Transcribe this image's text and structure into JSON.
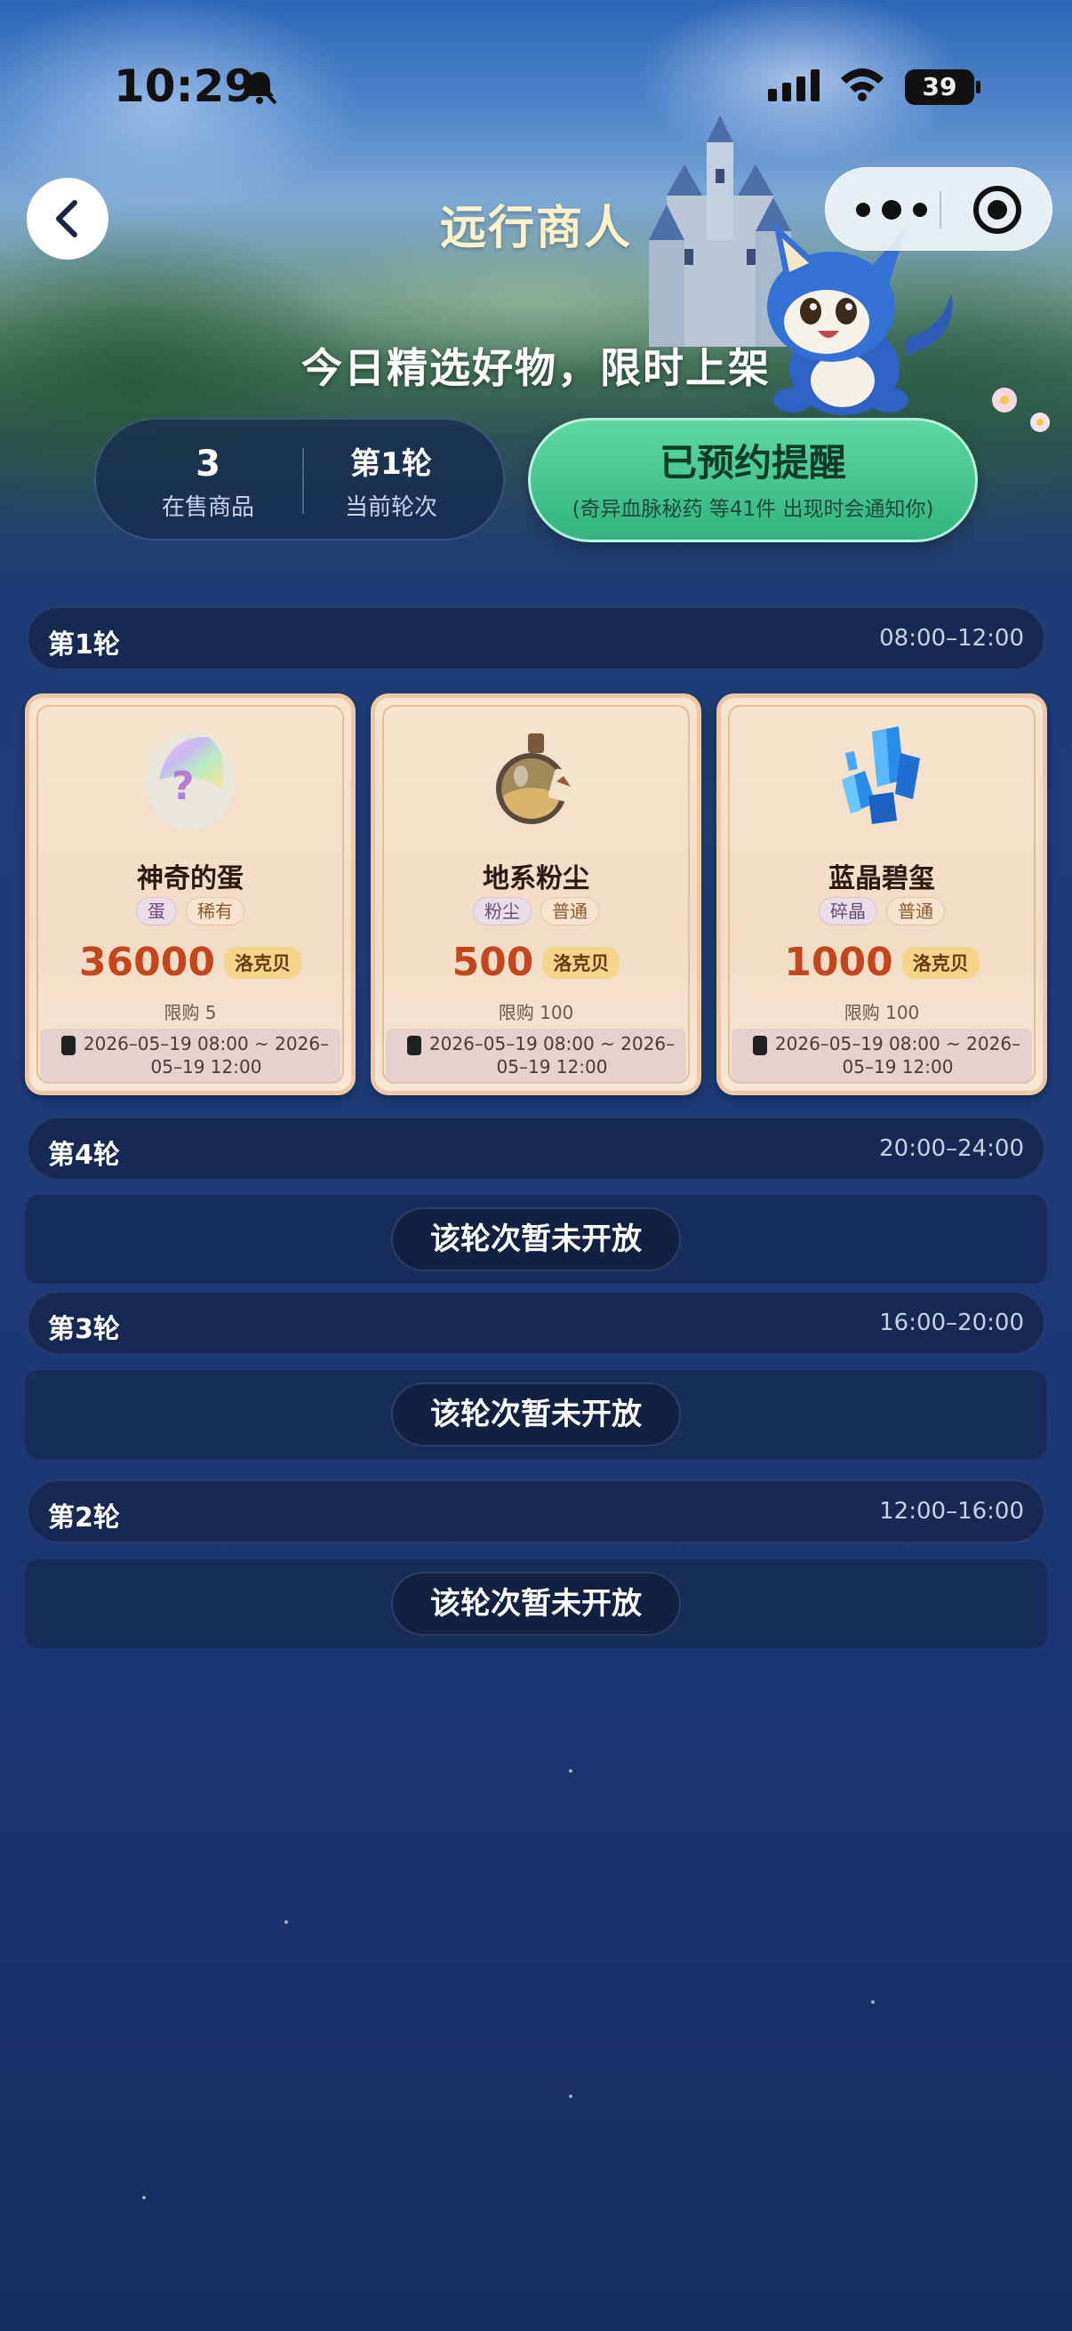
{
  "status_bar": {
    "time": "10:29",
    "battery": "39"
  },
  "nav": {
    "title": "远行商人"
  },
  "hero": {
    "slogan": "今日精选好物，限时上架"
  },
  "stats": {
    "on_sale_count": "3",
    "on_sale_label": "在售商品",
    "current_round": "第1轮",
    "current_round_label": "当前轮次"
  },
  "reminder": {
    "label": "已预约提醒",
    "sub": "(奇异血脉秘药 等41件 出现时会通知你)"
  },
  "rounds": [
    {
      "name": "第1轮",
      "time": "08:00–12:00",
      "items": [
        {
          "name": "神奇的蛋",
          "tags": [
            "蛋",
            "稀有"
          ],
          "price": "36000",
          "currency": "洛克贝",
          "limit": "限购 5",
          "period": "2026–05–19 08:00 ~ 2026–05–19 12:00",
          "icon": "rainbow-egg-icon"
        },
        {
          "name": "地系粉尘",
          "tags": [
            "粉尘",
            "普通"
          ],
          "price": "500",
          "currency": "洛克贝",
          "limit": "限购 100",
          "period": "2026–05–19 08:00 ~ 2026–05–19 12:00",
          "icon": "dust-bottle-icon"
        },
        {
          "name": "蓝晶碧玺",
          "tags": [
            "碎晶",
            "普通"
          ],
          "price": "1000",
          "currency": "洛克贝",
          "limit": "限购 100",
          "period": "2026–05–19 08:00 ~ 2026–05–19 12:00",
          "icon": "blue-crystal-icon"
        }
      ]
    },
    {
      "name": "第4轮",
      "time": "20:00–24:00",
      "status": "该轮次暂未开放"
    },
    {
      "name": "第3轮",
      "time": "16:00–20:00",
      "status": "该轮次暂未开放"
    },
    {
      "name": "第2轮",
      "time": "12:00–16:00",
      "status": "该轮次暂未开放"
    }
  ],
  "colors": {
    "accent_green": "#33b381",
    "price_red": "#c2461e",
    "page_bg": "#1d3a77"
  }
}
